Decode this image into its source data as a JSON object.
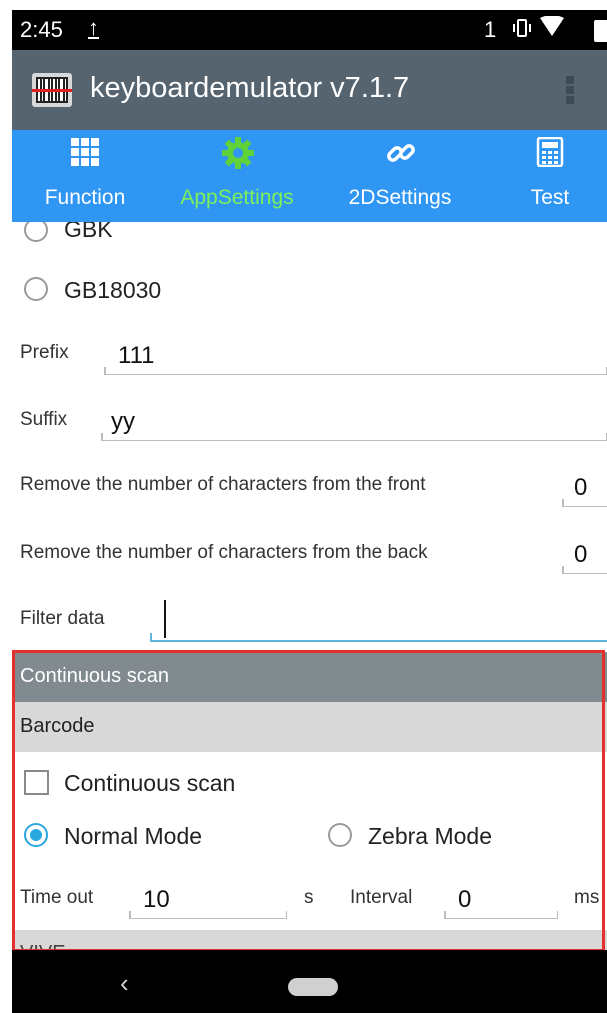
{
  "status_bar": {
    "time": "2:45",
    "upload_glyph": "↑",
    "sim": "1",
    "vibrate_glyph": "◖▯◗",
    "wifi_glyph": "▼"
  },
  "app_bar": {
    "title": "keyboardemulator v7.1.7",
    "logo_icon": "barcode-icon",
    "menu_icon": "overflow-menu-icon"
  },
  "tabs": [
    {
      "label": "Function",
      "icon": "grid-icon",
      "active": false
    },
    {
      "label": "AppSettings",
      "icon": "gear-icon",
      "active": true
    },
    {
      "label": "2DSettings",
      "icon": "link-icon",
      "active": false
    },
    {
      "label": "Test",
      "icon": "calculator-icon",
      "active": false
    }
  ],
  "encoding": {
    "options": [
      {
        "label": "GBK",
        "selected": false
      },
      {
        "label": "GB18030",
        "selected": false
      }
    ]
  },
  "prefix": {
    "label": "Prefix",
    "value": "111"
  },
  "suffix": {
    "label": "Suffix",
    "value": "yy"
  },
  "remove_front": {
    "label": "Remove the number of characters from the front",
    "value": "0"
  },
  "remove_back": {
    "label": "Remove the number of characters from the back",
    "value": "0"
  },
  "filter": {
    "label": "Filter data",
    "value": ""
  },
  "continuous_scan_section": {
    "header": "Continuous scan",
    "subheader": "Barcode",
    "checkbox_label": "Continuous scan",
    "checkbox_checked": false,
    "modes": [
      {
        "label": "Normal Mode",
        "selected": true
      },
      {
        "label": "Zebra Mode",
        "selected": false
      }
    ],
    "timeout": {
      "label": "Time out",
      "value": "10",
      "unit": "s"
    },
    "interval": {
      "label": "Interval",
      "value": "0",
      "unit": "ms"
    },
    "next_header_partial": "VIVE"
  },
  "colors": {
    "status_bar": "#000000",
    "app_bar": "#55646f",
    "tab_bar": "#2f96f3",
    "active_tab": "#7ef05a",
    "radio_selected": "#2aa8e0",
    "highlight_box": "#e53030"
  }
}
